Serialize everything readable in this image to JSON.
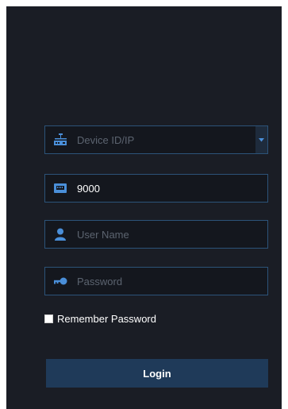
{
  "form": {
    "device": {
      "placeholder": "Device ID/IP",
      "icon": "network-device-icon"
    },
    "port": {
      "value": "9000",
      "icon": "port-icon"
    },
    "username": {
      "placeholder": "User Name",
      "icon": "user-icon"
    },
    "password": {
      "placeholder": "Password",
      "icon": "key-icon"
    },
    "remember_label": "Remember Password",
    "remember_checked": false,
    "login_label": "Login"
  },
  "colors": {
    "panel_bg": "#1a1d25",
    "field_border": "#2c5379",
    "icon_accent": "#4a8fd9",
    "button_bg": "#1f3a59"
  }
}
